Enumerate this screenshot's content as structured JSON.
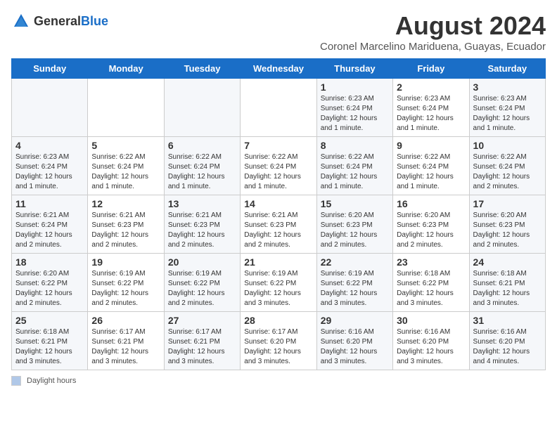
{
  "logo": {
    "general": "General",
    "blue": "Blue"
  },
  "title": "August 2024",
  "subtitle": "Coronel Marcelino Mariduena, Guayas, Ecuador",
  "days": [
    "Sunday",
    "Monday",
    "Tuesday",
    "Wednesday",
    "Thursday",
    "Friday",
    "Saturday"
  ],
  "weeks": [
    [
      {
        "date": "",
        "info": ""
      },
      {
        "date": "",
        "info": ""
      },
      {
        "date": "",
        "info": ""
      },
      {
        "date": "",
        "info": ""
      },
      {
        "date": "1",
        "info": "Sunrise: 6:23 AM\nSunset: 6:24 PM\nDaylight: 12 hours and 1 minute."
      },
      {
        "date": "2",
        "info": "Sunrise: 6:23 AM\nSunset: 6:24 PM\nDaylight: 12 hours and 1 minute."
      },
      {
        "date": "3",
        "info": "Sunrise: 6:23 AM\nSunset: 6:24 PM\nDaylight: 12 hours and 1 minute."
      }
    ],
    [
      {
        "date": "4",
        "info": "Sunrise: 6:23 AM\nSunset: 6:24 PM\nDaylight: 12 hours and 1 minute."
      },
      {
        "date": "5",
        "info": "Sunrise: 6:22 AM\nSunset: 6:24 PM\nDaylight: 12 hours and 1 minute."
      },
      {
        "date": "6",
        "info": "Sunrise: 6:22 AM\nSunset: 6:24 PM\nDaylight: 12 hours and 1 minute."
      },
      {
        "date": "7",
        "info": "Sunrise: 6:22 AM\nSunset: 6:24 PM\nDaylight: 12 hours and 1 minute."
      },
      {
        "date": "8",
        "info": "Sunrise: 6:22 AM\nSunset: 6:24 PM\nDaylight: 12 hours and 1 minute."
      },
      {
        "date": "9",
        "info": "Sunrise: 6:22 AM\nSunset: 6:24 PM\nDaylight: 12 hours and 1 minute."
      },
      {
        "date": "10",
        "info": "Sunrise: 6:22 AM\nSunset: 6:24 PM\nDaylight: 12 hours and 2 minutes."
      }
    ],
    [
      {
        "date": "11",
        "info": "Sunrise: 6:21 AM\nSunset: 6:24 PM\nDaylight: 12 hours and 2 minutes."
      },
      {
        "date": "12",
        "info": "Sunrise: 6:21 AM\nSunset: 6:23 PM\nDaylight: 12 hours and 2 minutes."
      },
      {
        "date": "13",
        "info": "Sunrise: 6:21 AM\nSunset: 6:23 PM\nDaylight: 12 hours and 2 minutes."
      },
      {
        "date": "14",
        "info": "Sunrise: 6:21 AM\nSunset: 6:23 PM\nDaylight: 12 hours and 2 minutes."
      },
      {
        "date": "15",
        "info": "Sunrise: 6:20 AM\nSunset: 6:23 PM\nDaylight: 12 hours and 2 minutes."
      },
      {
        "date": "16",
        "info": "Sunrise: 6:20 AM\nSunset: 6:23 PM\nDaylight: 12 hours and 2 minutes."
      },
      {
        "date": "17",
        "info": "Sunrise: 6:20 AM\nSunset: 6:23 PM\nDaylight: 12 hours and 2 minutes."
      }
    ],
    [
      {
        "date": "18",
        "info": "Sunrise: 6:20 AM\nSunset: 6:22 PM\nDaylight: 12 hours and 2 minutes."
      },
      {
        "date": "19",
        "info": "Sunrise: 6:19 AM\nSunset: 6:22 PM\nDaylight: 12 hours and 2 minutes."
      },
      {
        "date": "20",
        "info": "Sunrise: 6:19 AM\nSunset: 6:22 PM\nDaylight: 12 hours and 2 minutes."
      },
      {
        "date": "21",
        "info": "Sunrise: 6:19 AM\nSunset: 6:22 PM\nDaylight: 12 hours and 3 minutes."
      },
      {
        "date": "22",
        "info": "Sunrise: 6:19 AM\nSunset: 6:22 PM\nDaylight: 12 hours and 3 minutes."
      },
      {
        "date": "23",
        "info": "Sunrise: 6:18 AM\nSunset: 6:22 PM\nDaylight: 12 hours and 3 minutes."
      },
      {
        "date": "24",
        "info": "Sunrise: 6:18 AM\nSunset: 6:21 PM\nDaylight: 12 hours and 3 minutes."
      }
    ],
    [
      {
        "date": "25",
        "info": "Sunrise: 6:18 AM\nSunset: 6:21 PM\nDaylight: 12 hours and 3 minutes."
      },
      {
        "date": "26",
        "info": "Sunrise: 6:17 AM\nSunset: 6:21 PM\nDaylight: 12 hours and 3 minutes."
      },
      {
        "date": "27",
        "info": "Sunrise: 6:17 AM\nSunset: 6:21 PM\nDaylight: 12 hours and 3 minutes."
      },
      {
        "date": "28",
        "info": "Sunrise: 6:17 AM\nSunset: 6:20 PM\nDaylight: 12 hours and 3 minutes."
      },
      {
        "date": "29",
        "info": "Sunrise: 6:16 AM\nSunset: 6:20 PM\nDaylight: 12 hours and 3 minutes."
      },
      {
        "date": "30",
        "info": "Sunrise: 6:16 AM\nSunset: 6:20 PM\nDaylight: 12 hours and 3 minutes."
      },
      {
        "date": "31",
        "info": "Sunrise: 6:16 AM\nSunset: 6:20 PM\nDaylight: 12 hours and 4 minutes."
      }
    ]
  ],
  "legend": {
    "label": "Daylight hours"
  }
}
